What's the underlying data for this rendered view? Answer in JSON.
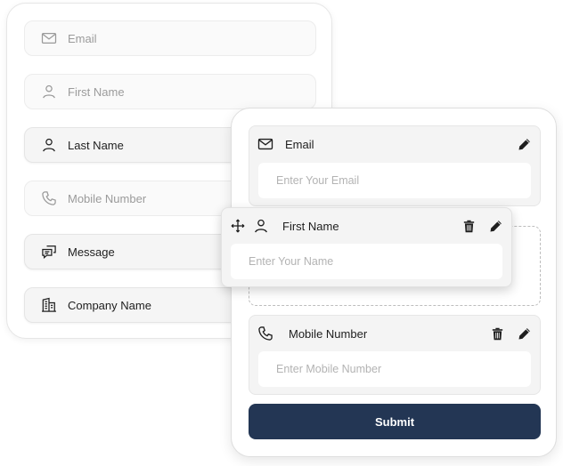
{
  "palette": {
    "items": [
      {
        "label": "Email",
        "icon": "mail-icon",
        "state": "placeholder"
      },
      {
        "label": "First Name",
        "icon": "user-icon",
        "state": "placeholder"
      },
      {
        "label": "Last Name",
        "icon": "user-icon",
        "state": "filled"
      },
      {
        "label": "Mobile Number",
        "icon": "phone-icon",
        "state": "placeholder"
      },
      {
        "label": "Message",
        "icon": "message-icon",
        "state": "filled"
      },
      {
        "label": "Company Name",
        "icon": "building-icon",
        "state": "filled"
      }
    ]
  },
  "form": {
    "email_field": {
      "label": "Email",
      "placeholder": "Enter Your Email",
      "icon": "mail-icon"
    },
    "mobile_field": {
      "label": "Mobile Number",
      "placeholder": "Enter Mobile Number",
      "icon": "phone-icon"
    },
    "submit_label": "Submit"
  },
  "dragged_field": {
    "label": "First Name",
    "placeholder": "Enter Your Name",
    "icon": "user-icon"
  },
  "colors": {
    "submit_bg": "#233654",
    "card_bg": "#f4f4f4",
    "placeholder_text": "#b3b3b3"
  }
}
